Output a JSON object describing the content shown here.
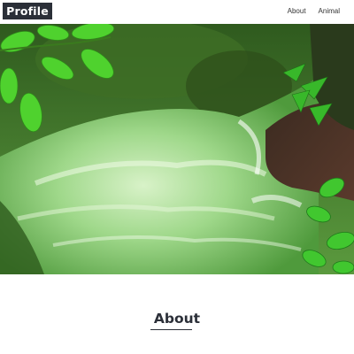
{
  "header": {
    "logo_text": "Profile",
    "nav": [
      {
        "label": "About"
      },
      {
        "label": "Animal"
      }
    ]
  },
  "hero": {
    "image": "mountain-stream-photo"
  },
  "about": {
    "title": "About"
  },
  "colors": {
    "logo_bg": "#2b2f38",
    "text_dark": "#2b2f38",
    "background": "#ffffff"
  }
}
